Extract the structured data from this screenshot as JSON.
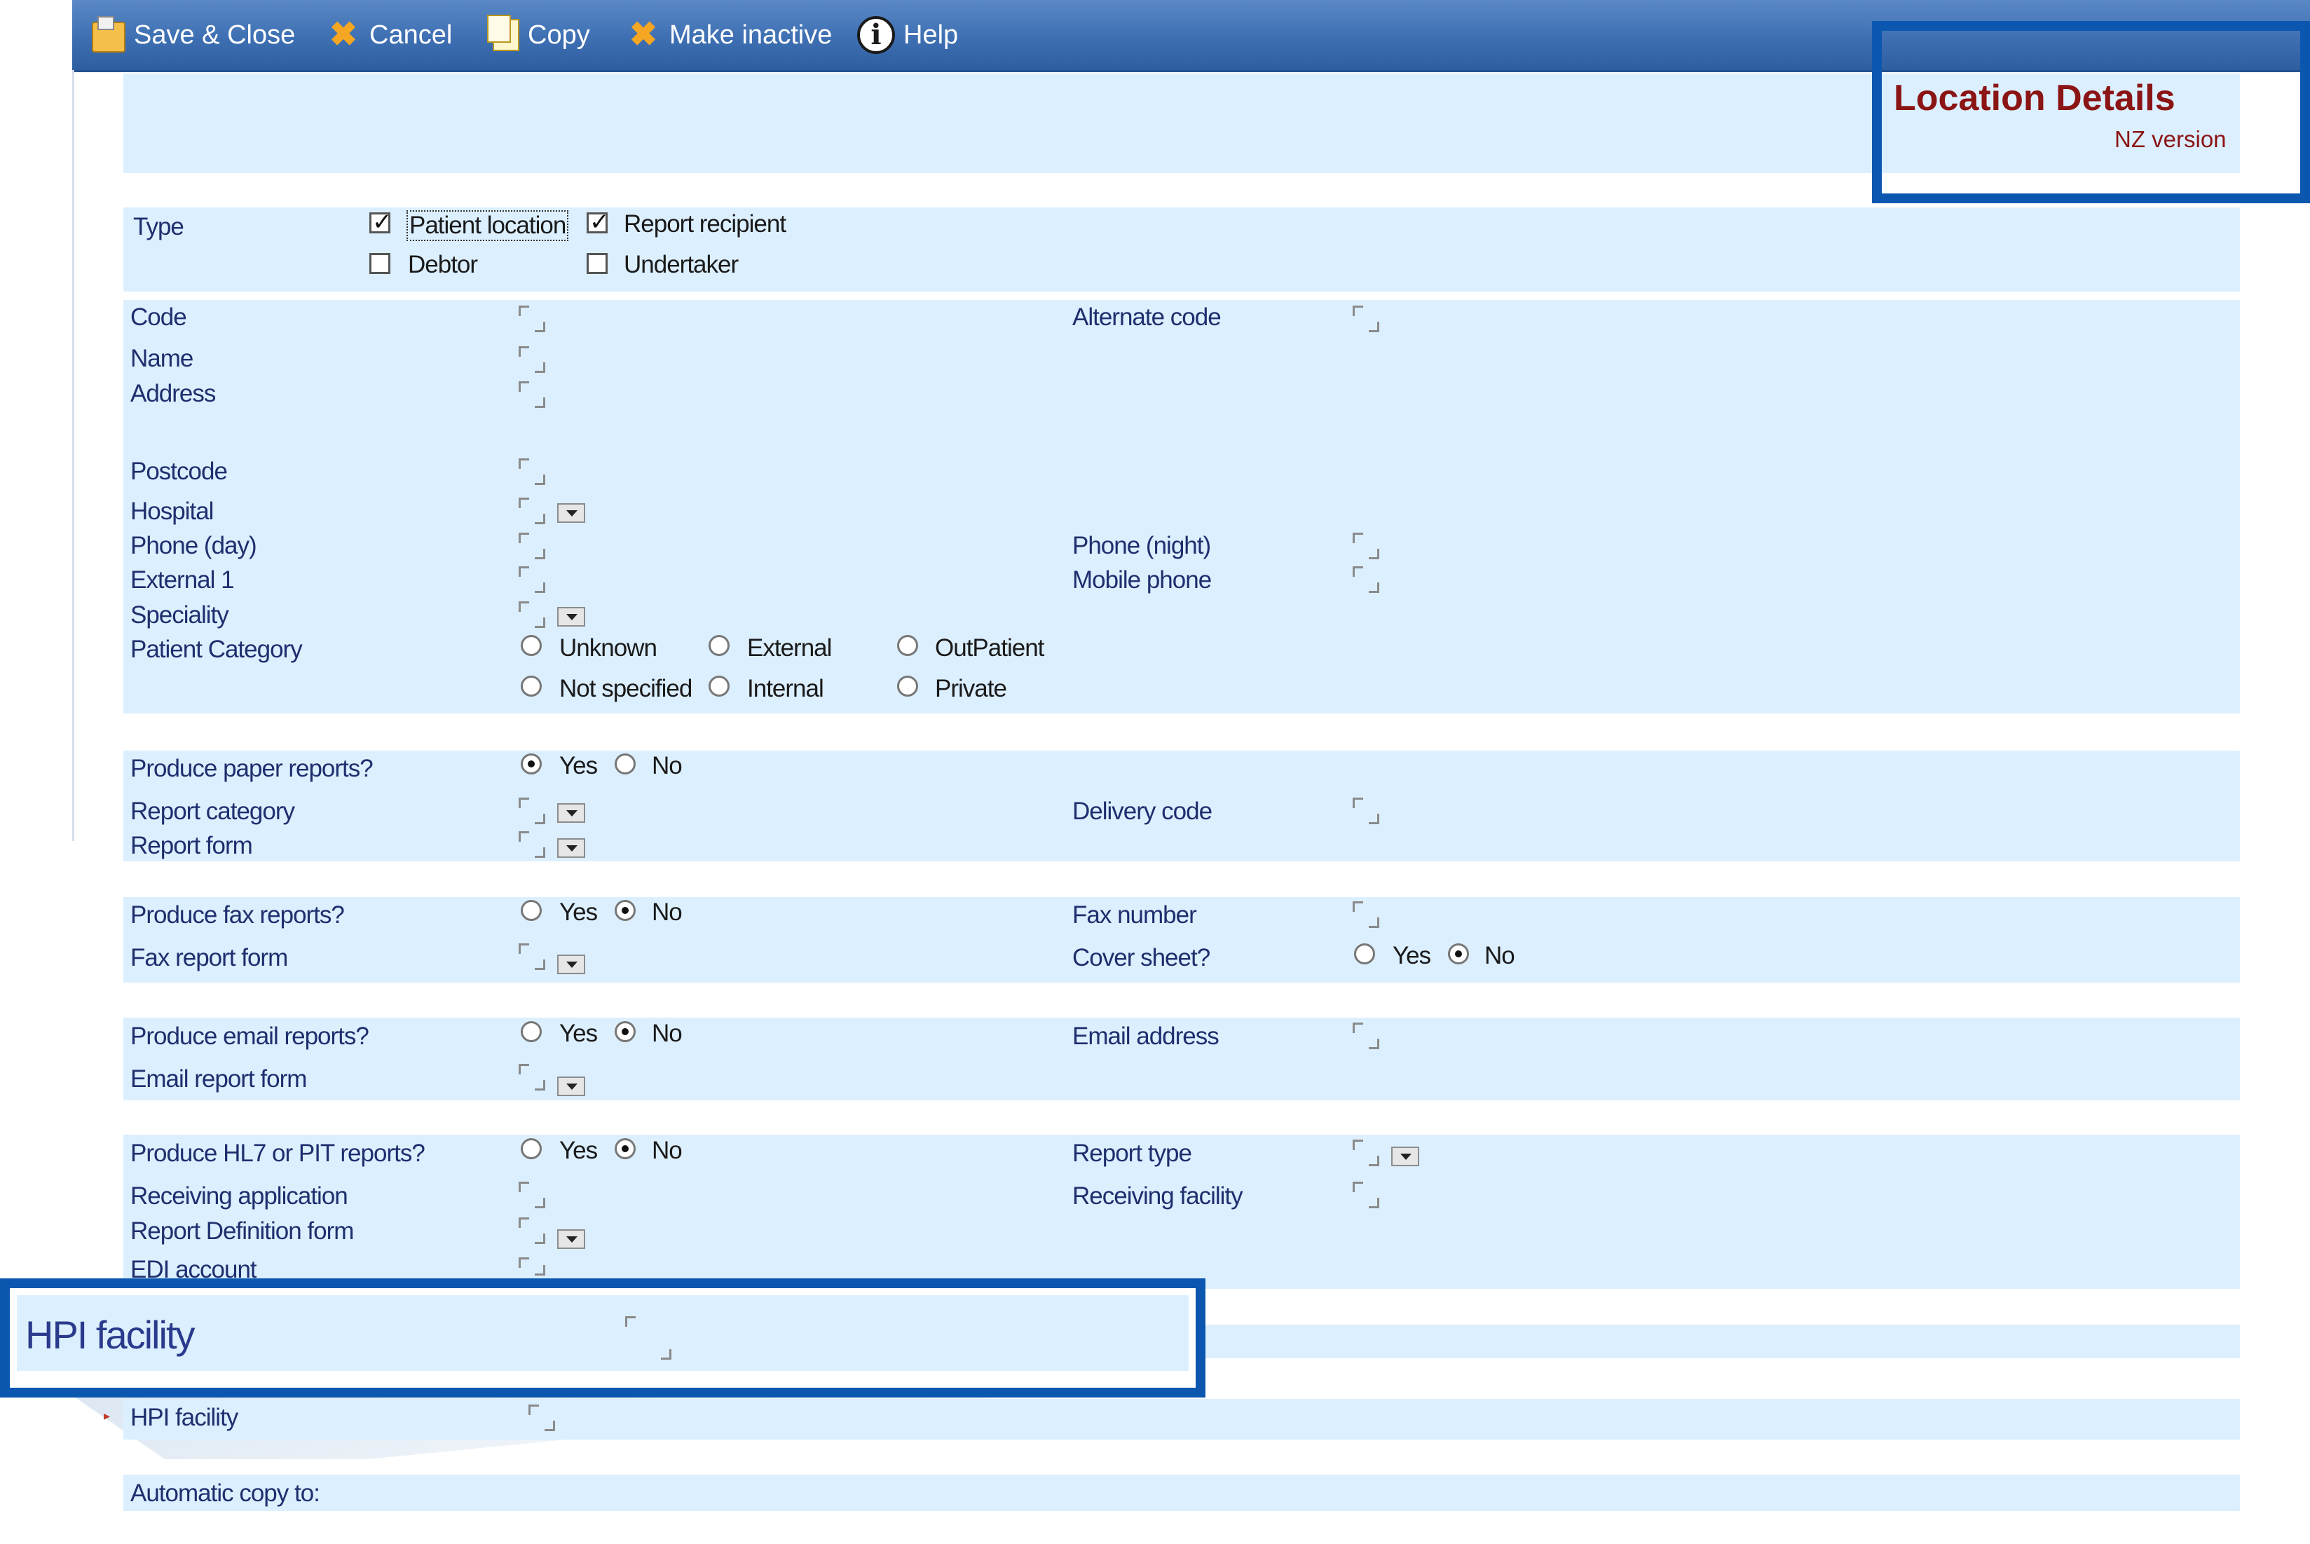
{
  "toolbar": {
    "save_close": "Save & Close",
    "cancel": "Cancel",
    "copy": "Copy",
    "make_inactive": "Make inactive",
    "help": "Help"
  },
  "header": {
    "title": "Location Details",
    "subtitle": "NZ version"
  },
  "type_section": {
    "label": "Type",
    "options": [
      {
        "label": "Patient location",
        "checked": true
      },
      {
        "label": "Report recipient",
        "checked": true
      },
      {
        "label": "Debtor",
        "checked": false
      },
      {
        "label": "Undertaker",
        "checked": false
      }
    ]
  },
  "details": {
    "code": "Code",
    "alternate_code": "Alternate code",
    "name": "Name",
    "address": "Address",
    "postcode": "Postcode",
    "hospital": "Hospital",
    "phone_day": "Phone (day)",
    "phone_night": "Phone (night)",
    "external1": "External 1",
    "mobile_phone": "Mobile phone",
    "speciality": "Speciality",
    "patient_category": "Patient Category",
    "patient_category_options": [
      {
        "label": "Unknown",
        "checked": false
      },
      {
        "label": "External",
        "checked": false
      },
      {
        "label": "OutPatient",
        "checked": false
      },
      {
        "label": "Not specified",
        "checked": false
      },
      {
        "label": "Internal",
        "checked": false
      },
      {
        "label": "Private",
        "checked": false
      }
    ]
  },
  "paper": {
    "question": "Produce paper reports?",
    "yes": "Yes",
    "no": "No",
    "selected": "Yes",
    "report_category": "Report category",
    "delivery_code": "Delivery code",
    "report_form": "Report form"
  },
  "fax": {
    "question": "Produce fax reports?",
    "yes": "Yes",
    "no": "No",
    "selected": "No",
    "fax_number": "Fax number",
    "fax_report_form": "Fax report form",
    "cover_sheet": "Cover sheet?",
    "cover_yes": "Yes",
    "cover_no": "No",
    "cover_selected": "No"
  },
  "email": {
    "question": "Produce email reports?",
    "yes": "Yes",
    "no": "No",
    "selected": "No",
    "email_address": "Email address",
    "email_report_form": "Email report form"
  },
  "hl7": {
    "question": "Produce HL7 or PIT reports?",
    "yes": "Yes",
    "no": "No",
    "selected": "No",
    "report_type": "Report type",
    "receiving_application": "Receiving application",
    "receiving_facility": "Receiving facility",
    "report_definition_form": "Report Definition form",
    "edi_account": "EDI account"
  },
  "hpi": {
    "callout_label": "HPI facility",
    "label": "HPI facility"
  },
  "automatic_copy": {
    "label": "Automatic copy to:"
  },
  "colors": {
    "toolbar": "#3d6fb2",
    "panel": "#dcefff",
    "highlight": "#0b57b0",
    "title": "#8b1414"
  }
}
